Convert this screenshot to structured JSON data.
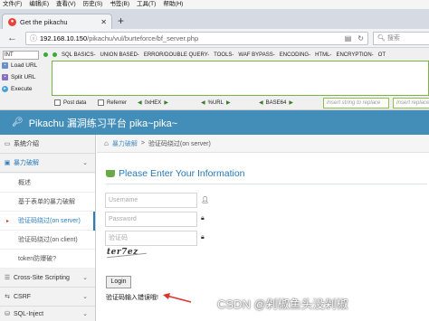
{
  "browser": {
    "menu": [
      "文件(F)",
      "编辑(E)",
      "查看(V)",
      "历史(S)",
      "书签(B)",
      "工具(T)",
      "帮助(H)"
    ],
    "tab_title": "Get the pikachu",
    "url_domain": "192.168.10.150",
    "url_path": "/pikachu/vul/burteforce/bf_server.php",
    "search_placeholder": "搜索"
  },
  "hackbar": {
    "type_select": "INT",
    "menus": [
      "SQL BASICS-",
      "UNION BASED-",
      "ERROR/DOUBLE QUERY-",
      "TOOLS-",
      "WAF BYPASS-",
      "ENCODING-",
      "HTML-",
      "ENCRYPTION-",
      "OT"
    ],
    "load_url": "Load URL",
    "split_url": "Split URL",
    "execute": "Execute",
    "post_data": "Post data",
    "referrer": "Referrer",
    "hex": "0xHEX",
    "url_enc": "%URL",
    "base64": "BASE64",
    "insert_placeholder_1": "Insert string to replace",
    "insert_placeholder_2": "Insert replacem"
  },
  "app": {
    "title": "Pikachu 漏洞练习平台 pika~pika~"
  },
  "sidebar": {
    "items": [
      {
        "label": "系统介绍"
      },
      {
        "label": "暴力破解"
      },
      {
        "label": "Cross-Site Scripting"
      },
      {
        "label": "CSRF"
      },
      {
        "label": "SQL-Inject"
      }
    ],
    "subitems": [
      {
        "label": "概述"
      },
      {
        "label": "基于表单的暴力破解"
      },
      {
        "label": "验证码绕过(on server)"
      },
      {
        "label": "验证码绕过(on client)"
      },
      {
        "label": "token防爆破?"
      }
    ]
  },
  "breadcrumb": {
    "section": "暴力破解",
    "separator": ">",
    "current": "验证码绕过(on server)"
  },
  "main": {
    "heading": "Please Enter Your Information",
    "username_placeholder": "Username",
    "password_placeholder": "Password",
    "captcha_placeholder": "验证码",
    "captcha_text": "ter7ez",
    "login_label": "Login",
    "error_message": "验证码输入错误哦!"
  },
  "watermark": "CSDN @剁椒鱼头没剁椒",
  "colors": {
    "header_bg": "#438eb9",
    "link": "#4c8fbd",
    "heading": "#2679b5",
    "arrow": "#d9342b"
  }
}
